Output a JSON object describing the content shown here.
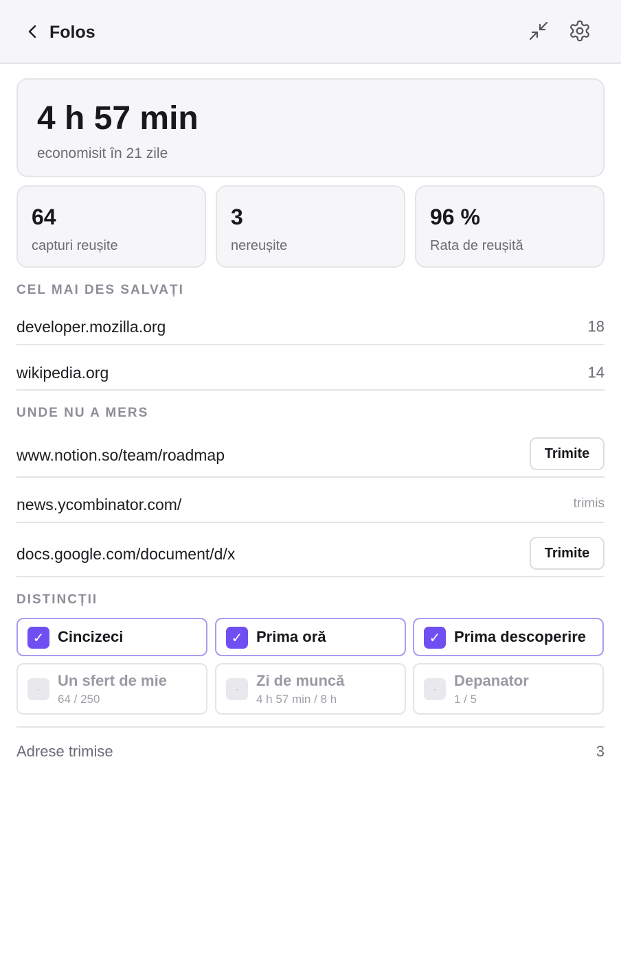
{
  "header": {
    "title": "Folos",
    "back_icon": "chevron-left-icon",
    "collapse_icon": "collapse-arrows-icon",
    "settings_icon": "gear-icon"
  },
  "summary": {
    "time_saved": "4 h 57 min",
    "period": "economisit în 21 zile"
  },
  "stats": [
    {
      "value": "64",
      "label": "capturi reușite"
    },
    {
      "value": "3",
      "label": "nereușite"
    },
    {
      "value": "96 %",
      "label": "Rata de reușită"
    }
  ],
  "top_saved": {
    "title": "CEL MAI DES SALVAȚI",
    "items": [
      {
        "domain": "developer.mozilla.org",
        "count": "18"
      },
      {
        "domain": "wikipedia.org",
        "count": "14"
      }
    ]
  },
  "failed": {
    "title": "UNDE NU A MERS",
    "send_label": "Trimite",
    "sent_label": "trimis",
    "items": [
      {
        "url": "www.notion.so/team/roadmap",
        "status": "send"
      },
      {
        "url": "news.ycombinator.com/",
        "status": "sent"
      },
      {
        "url": "docs.google.com/document/d/x",
        "status": "send"
      }
    ]
  },
  "badges": {
    "title": "DISTINCȚII",
    "earned": [
      {
        "name": "Cincizeci"
      },
      {
        "name": "Prima oră"
      },
      {
        "name": "Prima descoperire"
      }
    ],
    "locked": [
      {
        "name": "Un sfert de mie",
        "progress": "64 / 250"
      },
      {
        "name": "Zi de muncă",
        "progress": "4 h 57 min / 8 h"
      },
      {
        "name": "Depanator",
        "progress": "1 / 5"
      }
    ],
    "check_glyph": "✓",
    "locked_glyph": "·"
  },
  "footer": {
    "label": "Adrese trimise",
    "value": "3"
  },
  "colors": {
    "accent": "#6f4ff2",
    "accent_border": "#a99cf0",
    "card_bg": "#f6f6f8"
  }
}
